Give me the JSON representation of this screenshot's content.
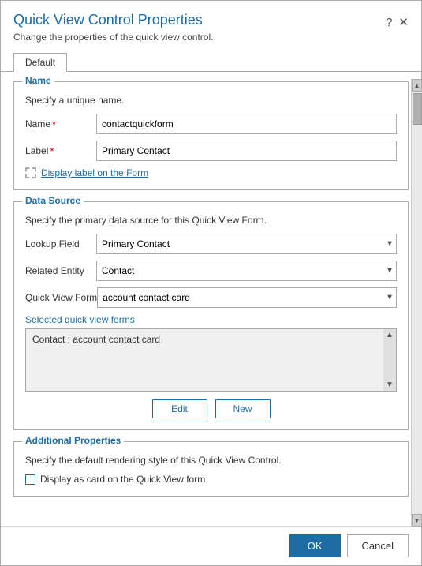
{
  "dialog": {
    "title": "Quick View Control Properties",
    "subtitle": "Change the properties of the quick view control.",
    "help_icon": "?",
    "close_icon": "✕"
  },
  "tabs": [
    {
      "label": "Default",
      "active": true
    }
  ],
  "name_section": {
    "legend": "Name",
    "description": "Specify a unique name.",
    "name_label": "Name",
    "name_required": "*",
    "name_value": "contactquickform",
    "label_label": "Label",
    "label_required": "*",
    "label_value": "Primary Contact",
    "checkbox_label": "Display label on the Form"
  },
  "datasource_section": {
    "legend": "Data Source",
    "description": "Specify the primary data source for this Quick View Form.",
    "lookup_label": "Lookup Field",
    "lookup_value": "Primary Contact",
    "lookup_options": [
      "Primary Contact"
    ],
    "entity_label": "Related Entity",
    "entity_value": "Contact",
    "entity_options": [
      "Contact"
    ],
    "form_label": "Quick View Form",
    "form_value": "account contact card",
    "form_options": [
      "account contact card"
    ],
    "selected_label": "Selected quick view forms",
    "selected_items": [
      "Contact : account contact card"
    ],
    "edit_button": "Edit",
    "new_button": "New"
  },
  "additional_section": {
    "legend": "Additional Properties",
    "description": "Specify the default rendering style of this Quick View Control.",
    "checkbox_label": "Display as card on the Quick View form"
  },
  "footer": {
    "ok_label": "OK",
    "cancel_label": "Cancel"
  }
}
